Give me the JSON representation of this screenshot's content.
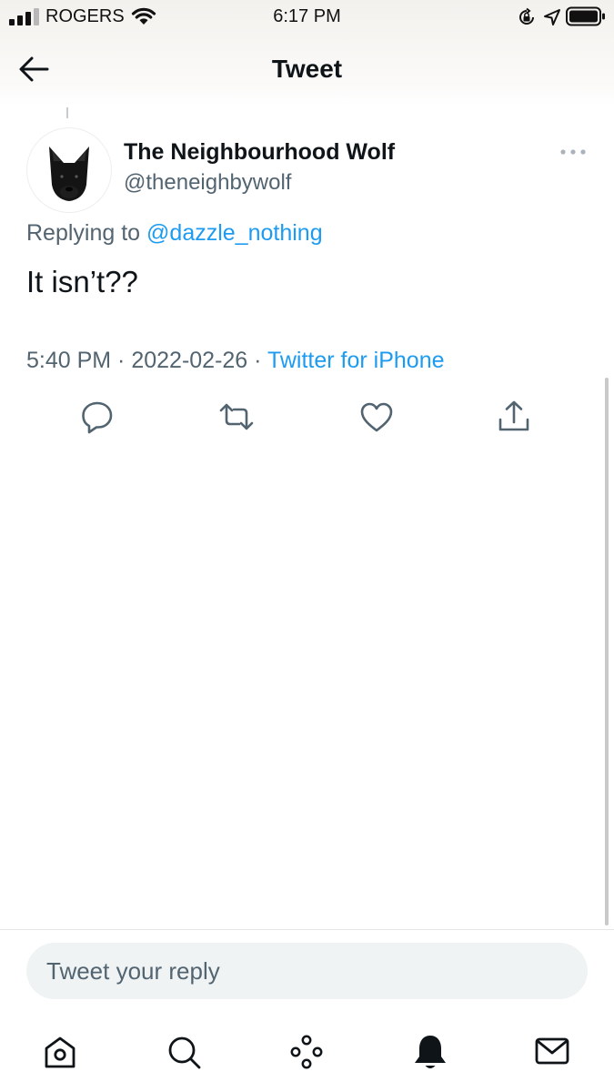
{
  "status_bar": {
    "carrier": "ROGERS",
    "time": "6:17 PM",
    "signal_icon": "cellular-signal-icon",
    "wifi_icon": "wifi-icon",
    "lock_icon": "rotation-lock-icon",
    "location_icon": "location-arrow-icon",
    "battery_icon": "battery-icon"
  },
  "nav": {
    "back_icon": "arrow-left-icon",
    "title": "Tweet"
  },
  "tweet": {
    "display_name": "The Neighbourhood Wolf",
    "handle": "@theneighbywolf",
    "avatar_icon": "black-dog-avatar",
    "more_icon": "more-dots-icon",
    "replying_prefix": "Replying to",
    "replying_to": "@dazzle_nothing",
    "text": "It isn’t??",
    "time": "5:40 PM",
    "separator": " · ",
    "date": "2022-02-26",
    "source": "Twitter for iPhone"
  },
  "actions": [
    {
      "name": "reply",
      "icon": "reply-bubble-icon"
    },
    {
      "name": "retweet",
      "icon": "retweet-icon"
    },
    {
      "name": "like",
      "icon": "heart-icon"
    },
    {
      "name": "share",
      "icon": "share-icon"
    }
  ],
  "reply_box": {
    "placeholder": "Tweet your reply"
  },
  "tab_bar": [
    {
      "name": "home",
      "icon": "home-icon"
    },
    {
      "name": "search",
      "icon": "search-icon"
    },
    {
      "name": "spaces",
      "icon": "spaces-icon"
    },
    {
      "name": "notifications",
      "icon": "bell-icon"
    },
    {
      "name": "messages",
      "icon": "envelope-icon"
    }
  ],
  "colors": {
    "accent": "#1d9bf0",
    "text_primary": "#0f1419",
    "text_secondary": "#536471",
    "input_bg": "#eff3f4"
  }
}
